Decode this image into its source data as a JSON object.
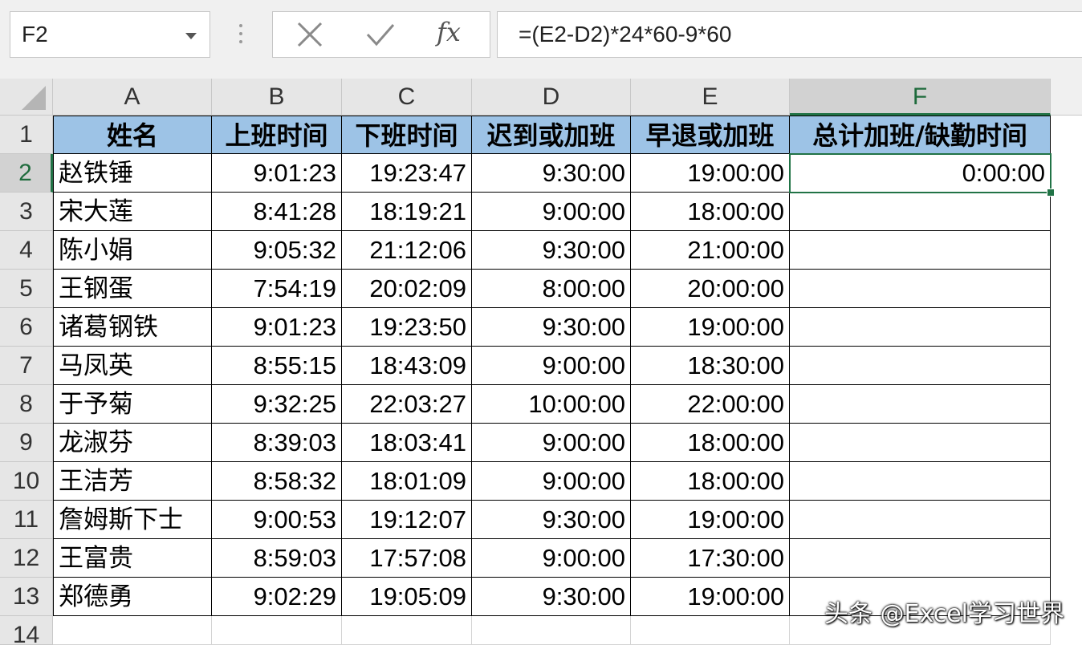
{
  "name_box": {
    "value": "F2"
  },
  "formula_bar": {
    "cancel_icon": "x-icon",
    "enter_icon": "check-icon",
    "fx_label": "fx",
    "formula": "=(E2-D2)*24*60-9*60"
  },
  "columns": [
    "A",
    "B",
    "C",
    "D",
    "E",
    "F"
  ],
  "rows": [
    "1",
    "2",
    "3",
    "4",
    "5",
    "6",
    "7",
    "8",
    "9",
    "10",
    "11",
    "12",
    "13",
    "14"
  ],
  "header_row": [
    "姓名",
    "上班时间",
    "下班时间",
    "迟到或加班",
    "早退或加班",
    "总计加班/缺勤时间"
  ],
  "data_rows": [
    [
      "赵铁锤",
      "9:01:23",
      "19:23:47",
      "9:30:00",
      "19:00:00",
      "0:00:00"
    ],
    [
      "宋大莲",
      "8:41:28",
      "18:19:21",
      "9:00:00",
      "18:00:00",
      ""
    ],
    [
      "陈小娟",
      "9:05:32",
      "21:12:06",
      "9:30:00",
      "21:00:00",
      ""
    ],
    [
      "王钢蛋",
      "7:54:19",
      "20:02:09",
      "8:00:00",
      "20:00:00",
      ""
    ],
    [
      "诸葛钢铁",
      "9:01:23",
      "19:23:50",
      "9:30:00",
      "19:00:00",
      ""
    ],
    [
      "马凤英",
      "8:55:15",
      "18:43:09",
      "9:00:00",
      "18:30:00",
      ""
    ],
    [
      "于予菊",
      "9:32:25",
      "22:03:27",
      "10:00:00",
      "22:00:00",
      ""
    ],
    [
      "龙淑芬",
      "8:39:03",
      "18:03:41",
      "9:00:00",
      "18:00:00",
      ""
    ],
    [
      "王洁芳",
      "8:58:32",
      "18:01:09",
      "9:00:00",
      "18:00:00",
      ""
    ],
    [
      "詹姆斯下士",
      "9:00:53",
      "19:12:07",
      "9:30:00",
      "19:00:00",
      ""
    ],
    [
      "王富贵",
      "8:59:03",
      "17:57:08",
      "9:00:00",
      "17:30:00",
      ""
    ],
    [
      "郑德勇",
      "9:02:29",
      "19:05:09",
      "9:30:00",
      "19:00:00",
      ""
    ]
  ],
  "selected_cell": "F2",
  "colors": {
    "header_fill": "#9dc3e6",
    "selection": "#217346"
  },
  "watermark": "头条 @Excel学习世界"
}
